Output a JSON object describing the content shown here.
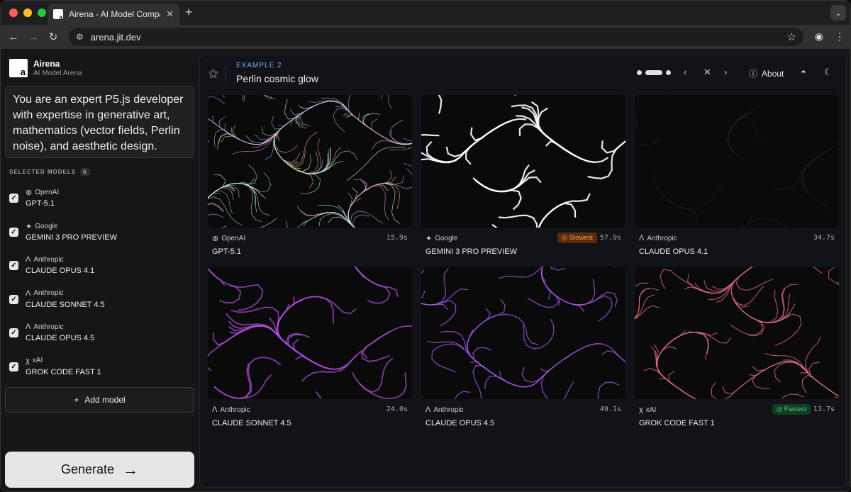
{
  "browser": {
    "tab_title": "Airena - AI Model Comparison",
    "url": "arena.jit.dev"
  },
  "sidebar": {
    "brand_name": "Airena",
    "brand_sub": "AI Model Arena",
    "prompt": "You are an expert P5.js developer with expertise in generative art, mathematics (vector fields, Perlin noise), and aesthetic design.",
    "selected_models_label": "SELECTED MODELS",
    "selected_count": "6",
    "models": [
      {
        "provider": "OpenAI",
        "name": "GPT-5.1",
        "icon": "openai-icon"
      },
      {
        "provider": "Google",
        "name": "GEMINI 3 PRO PREVIEW",
        "icon": "google-gemini-icon"
      },
      {
        "provider": "Anthropic",
        "name": "CLAUDE OPUS 4.1",
        "icon": "anthropic-icon"
      },
      {
        "provider": "Anthropic",
        "name": "CLAUDE SONNET 4.5",
        "icon": "anthropic-icon"
      },
      {
        "provider": "Anthropic",
        "name": "CLAUDE OPUS 4.5",
        "icon": "anthropic-icon"
      },
      {
        "provider": "xAI",
        "name": "GROK CODE FAST 1",
        "icon": "xai-icon"
      }
    ],
    "add_model": "Add model",
    "generate": "Generate"
  },
  "main": {
    "example_label": "EXAMPLE 2",
    "example_title": "Perlin cosmic glow",
    "about": "About",
    "results": [
      {
        "provider": "OpenAI",
        "name": "GPT-5.1",
        "time": "15.9s",
        "badge": "",
        "accent": "#c9a6e8"
      },
      {
        "provider": "Google",
        "name": "GEMINI 3 PRO PREVIEW",
        "time": "57.9s",
        "badge": "Slowest",
        "accent": "#ffffff"
      },
      {
        "provider": "Anthropic",
        "name": "CLAUDE OPUS 4.1",
        "time": "34.7s",
        "badge": "",
        "accent": "#4a5a50"
      },
      {
        "provider": "Anthropic",
        "name": "CLAUDE SONNET 4.5",
        "time": "24.0s",
        "badge": "",
        "accent": "#b04ee0"
      },
      {
        "provider": "Anthropic",
        "name": "CLAUDE OPUS 4.5",
        "time": "49.1s",
        "badge": "",
        "accent": "#a55ae8"
      },
      {
        "provider": "xAI",
        "name": "GROK CODE FAST 1",
        "time": "13.7s",
        "badge": "Fastest",
        "accent": "#e8728a"
      }
    ]
  }
}
